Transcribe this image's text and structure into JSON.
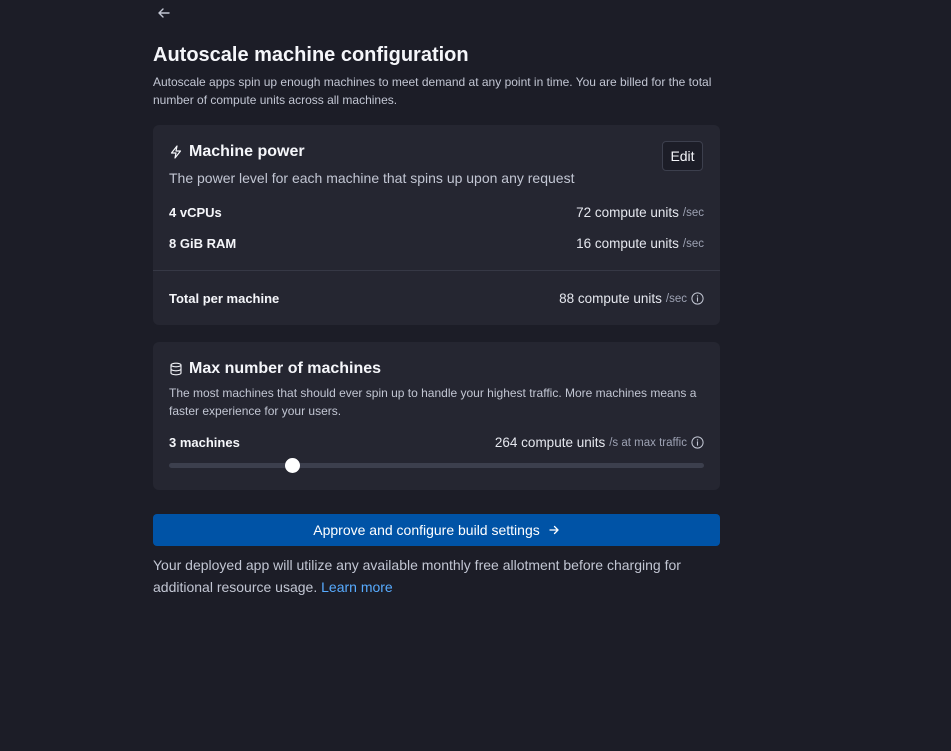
{
  "page": {
    "title": "Autoscale machine configuration",
    "subtitle": "Autoscale apps spin up enough machines to meet demand at any point in time. You are billed for the total number of compute units across all machines."
  },
  "machine_power": {
    "icon": "lightning-icon",
    "heading": "Machine power",
    "description": "The power level for each machine that spins up upon any request",
    "edit_label": "Edit",
    "rows": [
      {
        "label": "4 vCPUs",
        "value": "72 compute units",
        "unit": "/sec"
      },
      {
        "label": "8 GiB RAM",
        "value": "16 compute units",
        "unit": "/sec"
      }
    ],
    "total": {
      "label": "Total per machine",
      "value": "88 compute units",
      "unit": "/sec"
    }
  },
  "max_machines": {
    "icon": "database-icon",
    "heading": "Max number of machines",
    "description": "The most machines that should ever spin up to handle your highest traffic. More machines means a faster experience for your users.",
    "count_label": "3 machines",
    "value": "264 compute units",
    "unit": "/s at max traffic",
    "slider_fraction": 0.23
  },
  "primary_button": {
    "label": "Approve and configure build settings",
    "icon": "arrow-right-icon"
  },
  "footnote": {
    "text": "Your deployed app will utilize any available monthly free allotment before charging for additional resource usage.",
    "link": "Learn more"
  },
  "colors": {
    "background": "#1c1d27",
    "card": "#252631",
    "primary": "#0053a6",
    "link": "#57abff"
  }
}
